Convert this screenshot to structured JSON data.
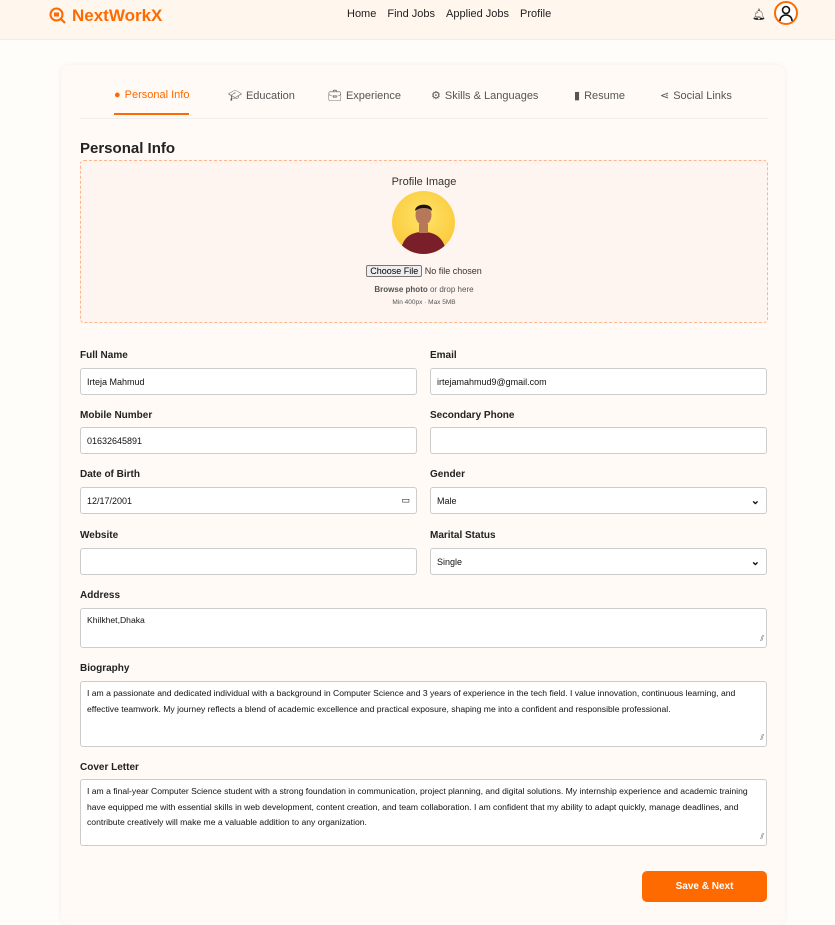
{
  "header": {
    "brand": "NextWorkX",
    "nav": [
      "Home",
      "Find Jobs",
      "Applied Jobs",
      "Profile"
    ]
  },
  "tabs": [
    "Personal Info",
    "Education",
    "Experience",
    "Skills & Languages",
    "Resume",
    "Social Links"
  ],
  "section_title": "Personal Info",
  "upload": {
    "label": "Profile Image",
    "choose_button": "Choose File",
    "file_status": "No file chosen",
    "browse_bold": "Browse photo",
    "browse_rest": "or drop here",
    "limits": "Min 400px · Max 5MB"
  },
  "fields": {
    "full_name": {
      "label": "Full Name",
      "value": "Irteja Mahmud"
    },
    "email": {
      "label": "Email",
      "value": "irtejamahmud9@gmail.com"
    },
    "mobile": {
      "label": "Mobile Number",
      "value": "01632645891"
    },
    "secondary_phone": {
      "label": "Secondary Phone",
      "value": ""
    },
    "dob": {
      "label": "Date of Birth",
      "value": "12/17/2001"
    },
    "gender": {
      "label": "Gender",
      "value": "Male"
    },
    "website": {
      "label": "Website",
      "value": ""
    },
    "marital": {
      "label": "Marital Status",
      "value": "Single"
    },
    "address": {
      "label": "Address",
      "value": "Khilkhet,Dhaka"
    },
    "biography": {
      "label": "Biography",
      "value": "I am a passionate and dedicated individual with a background in Computer Science and 3 years of experience in the tech field. I value innovation, continuous learning, and effective teamwork. My journey reflects a blend of academic excellence and practical exposure, shaping me into a confident and responsible professional."
    },
    "cover_letter": {
      "label": "Cover Letter",
      "value": "I am a final-year Computer Science student with a strong foundation in communication, project planning, and digital solutions. My internship experience and academic training have equipped me with essential skills in web development, content creation, and team collaboration. I am confident that my ability to adapt quickly, manage deadlines, and contribute creatively will make me a valuable addition to any organization."
    }
  },
  "save_button": "Save & Next",
  "colors": {
    "accent": "#ff6a00"
  }
}
